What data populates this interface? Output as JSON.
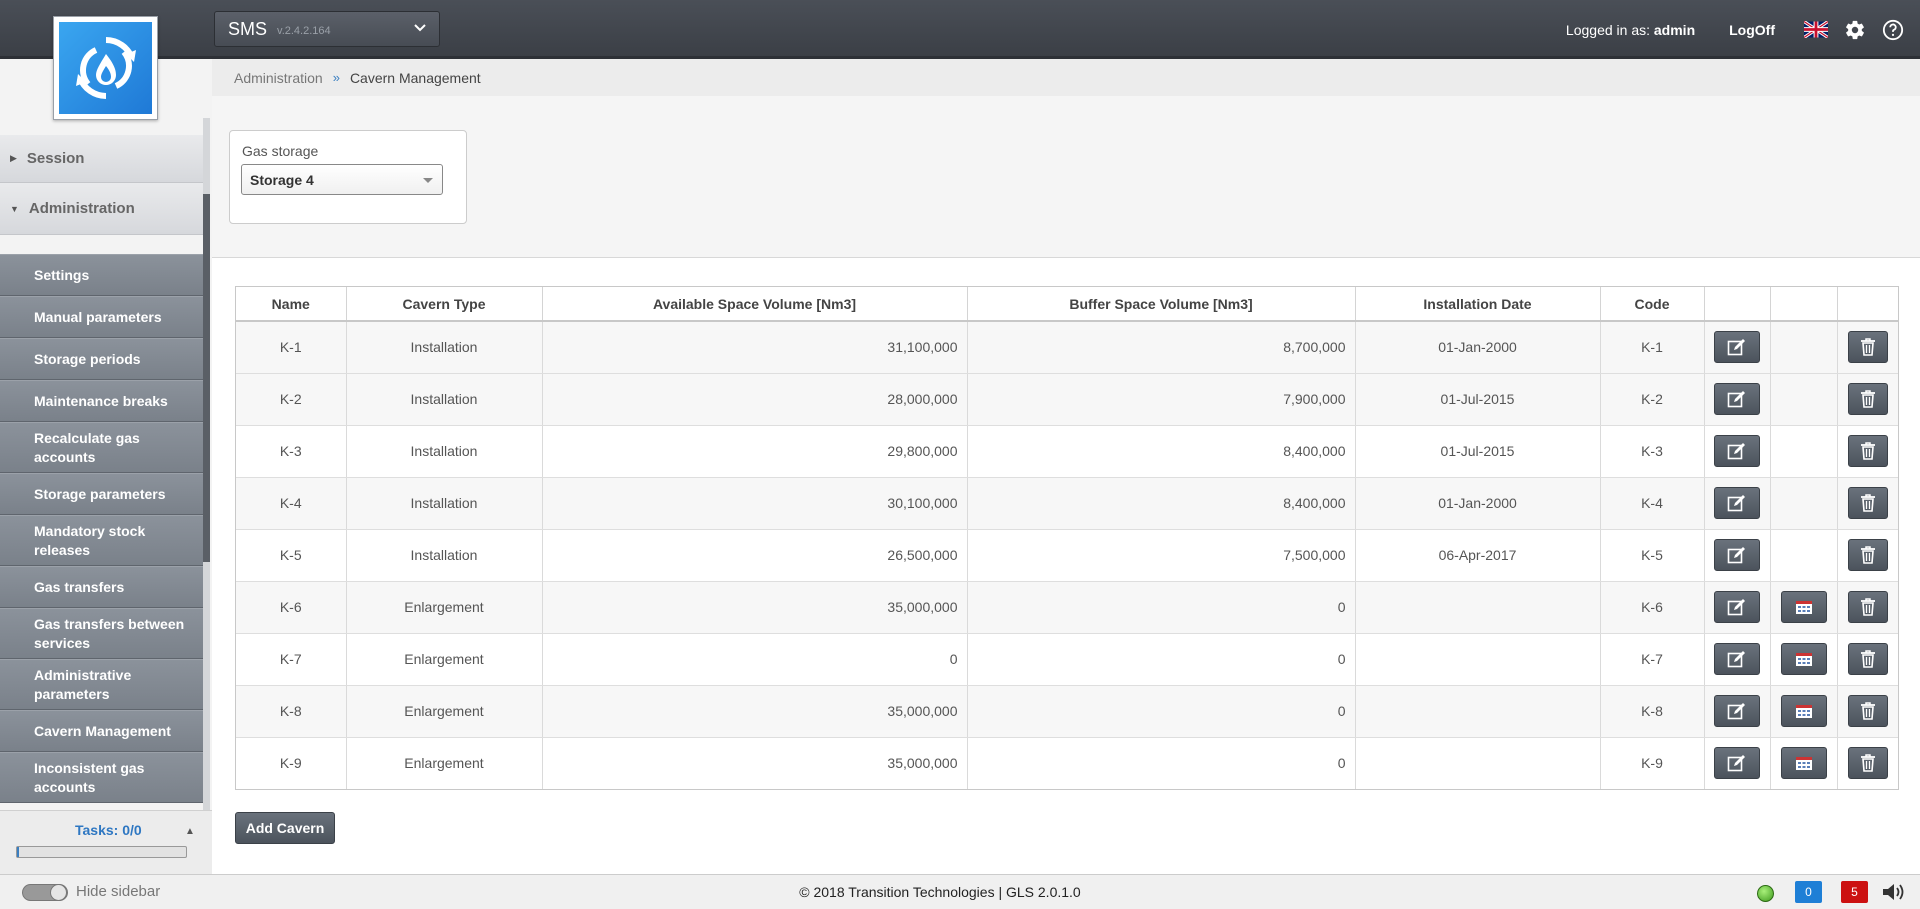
{
  "app": {
    "name": "SMS",
    "version": "v.2.4.2.164"
  },
  "header": {
    "logged_in_prefix": "Logged in as:",
    "user": "admin",
    "logoff": "LogOff"
  },
  "breadcrumb": {
    "root": "Administration",
    "sep": "»",
    "current": "Cavern Management"
  },
  "sidebar": {
    "sections": [
      "Session",
      "Administration"
    ],
    "items": [
      "Settings",
      "Manual parameters",
      "Storage periods",
      "Maintenance breaks",
      "Recalculate gas accounts",
      "Storage parameters",
      "Mandatory stock releases",
      "Gas transfers",
      "Gas transfers between services",
      "Administrative parameters",
      "Cavern Management",
      "Inconsistent gas accounts"
    ],
    "tasks": "Tasks: 0/0"
  },
  "filter": {
    "label": "Gas storage",
    "value": "Storage 4"
  },
  "table": {
    "columns": [
      "Name",
      "Cavern Type",
      "Available Space Volume [Nm3]",
      "Buffer Space Volume [Nm3]",
      "Installation Date",
      "Code",
      "",
      "",
      ""
    ],
    "rows": [
      {
        "name": "K-1",
        "type": "Installation",
        "avail": "31,100,000",
        "buffer": "8,700,000",
        "date": "01-Jan-2000",
        "code": "K-1",
        "calendar": false
      },
      {
        "name": "K-2",
        "type": "Installation",
        "avail": "28,000,000",
        "buffer": "7,900,000",
        "date": "01-Jul-2015",
        "code": "K-2",
        "calendar": false
      },
      {
        "name": "K-3",
        "type": "Installation",
        "avail": "29,800,000",
        "buffer": "8,400,000",
        "date": "01-Jul-2015",
        "code": "K-3",
        "calendar": false
      },
      {
        "name": "K-4",
        "type": "Installation",
        "avail": "30,100,000",
        "buffer": "8,400,000",
        "date": "01-Jan-2000",
        "code": "K-4",
        "calendar": false
      },
      {
        "name": "K-5",
        "type": "Installation",
        "avail": "26,500,000",
        "buffer": "7,500,000",
        "date": "06-Apr-2017",
        "code": "K-5",
        "calendar": false
      },
      {
        "name": "K-6",
        "type": "Enlargement",
        "avail": "35,000,000",
        "buffer": "0",
        "date": "",
        "code": "K-6",
        "calendar": true
      },
      {
        "name": "K-7",
        "type": "Enlargement",
        "avail": "0",
        "buffer": "0",
        "date": "",
        "code": "K-7",
        "calendar": true
      },
      {
        "name": "K-8",
        "type": "Enlargement",
        "avail": "35,000,000",
        "buffer": "0",
        "date": "",
        "code": "K-8",
        "calendar": true
      },
      {
        "name": "K-9",
        "type": "Enlargement",
        "avail": "35,000,000",
        "buffer": "0",
        "date": "",
        "code": "K-9",
        "calendar": true
      }
    ]
  },
  "actions": {
    "add": "Add Cavern"
  },
  "footer": {
    "hide_sidebar": "Hide sidebar",
    "copyright": "© 2018 Transition Technologies | GLS 2.0.1.0",
    "messages_count": "0",
    "alerts_count": "5"
  },
  "icons": {
    "logo": "gas-flame-refresh-icon",
    "flag": "uk-flag-icon",
    "settings": "gear-icon",
    "help": "help-icon",
    "edit": "edit-icon",
    "calendar": "calendar-icon",
    "delete": "trash-icon",
    "status": "status-dot-icon",
    "messages": "chat-icon",
    "alerts": "alert-icon",
    "sound": "speaker-icon"
  },
  "colors": {
    "primary_button": "#5a616a",
    "link": "#2e77c2",
    "status_ok": "#4caf1f",
    "alert": "#cc1111",
    "messages": "#1e7fd6"
  }
}
